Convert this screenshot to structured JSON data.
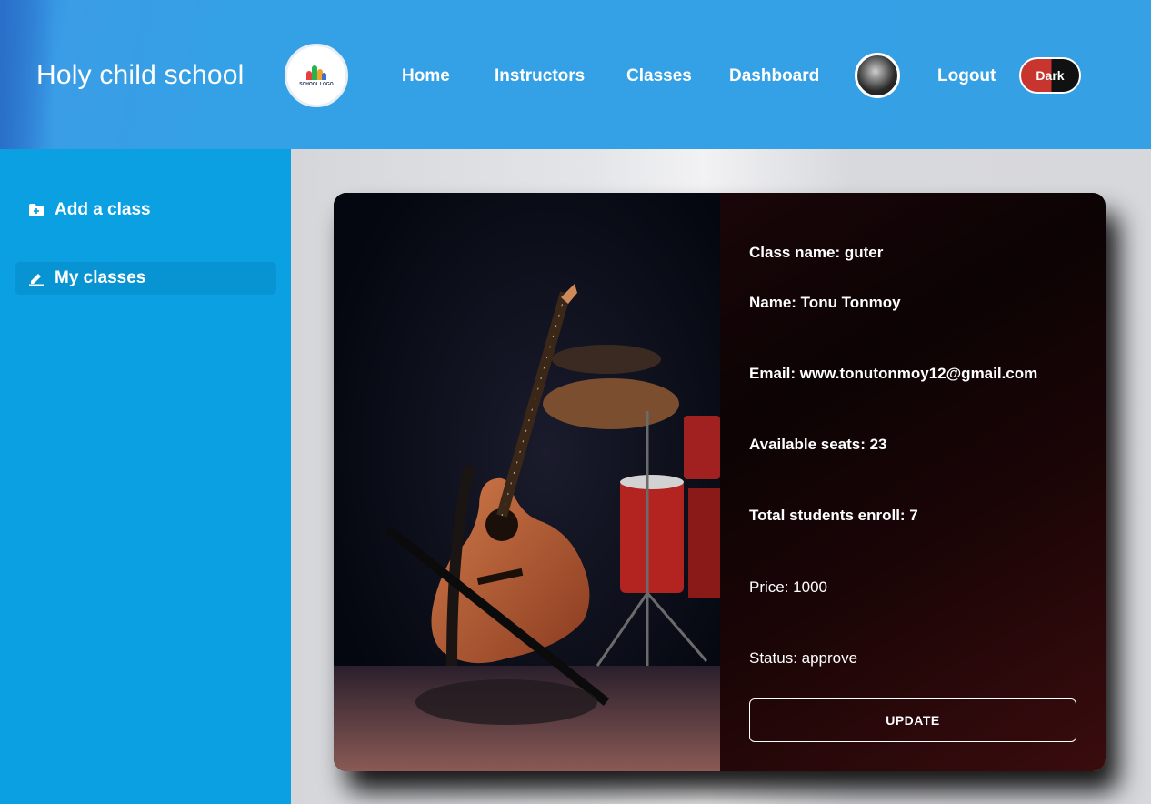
{
  "header": {
    "brand": "Holy child school",
    "logo_text": "SCHOOL LOGO",
    "nav": [
      {
        "label": "Home"
      },
      {
        "label": "Instructors"
      },
      {
        "label": "Classes"
      },
      {
        "label": "Dashboard"
      }
    ],
    "logout_label": "Logout",
    "theme_toggle_label": "Dark"
  },
  "sidebar": {
    "items": [
      {
        "label": "Add a class",
        "icon": "folder-plus-icon"
      },
      {
        "label": "My classes",
        "icon": "edit-icon",
        "active": true
      }
    ]
  },
  "class_card": {
    "image": "guitar-and-drums-photo",
    "class_name": "Class name: guter",
    "instructor_name": "Name: Tonu Tonmoy",
    "email": "Email: www.tonutonmoy12@gmail.com",
    "available_seats": "Available seats: 23",
    "total_enrolled": "Total students enroll: 7",
    "price": "Price: 1000",
    "status": "Status: approve",
    "update_label": "UPDATE"
  },
  "colors": {
    "header": "#35a0e4",
    "sidebar": "#0aa0e2",
    "card_info_bg": "#1a0608",
    "toggle_red": "#c8352e"
  }
}
